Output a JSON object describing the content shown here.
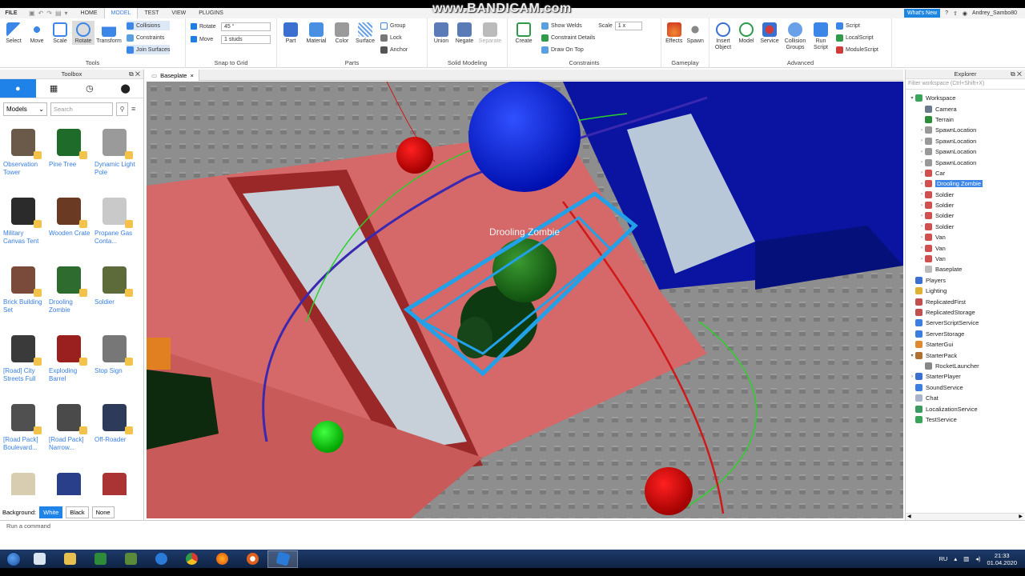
{
  "menubar": {
    "file": "FILE",
    "tabs": [
      "HOME",
      "MODEL",
      "TEST",
      "VIEW",
      "PLUGINS"
    ],
    "active_tab": "MODEL",
    "whats_new": "What's New",
    "user": "Andrey_Sambo80"
  },
  "watermark": "www.BANDICAM.com",
  "ribbon": {
    "tools": {
      "items": [
        "Select",
        "Move",
        "Scale",
        "Rotate",
        "Transform"
      ],
      "toggles": [
        "Collisions",
        "Constraints",
        "Join Surfaces"
      ],
      "label": "Tools"
    },
    "snap": {
      "rotate_label": "Rotate",
      "rotate_value": "45 °",
      "move_label": "Move",
      "move_value": "1 studs",
      "label": "Snap to Grid"
    },
    "parts": {
      "items": [
        "Part",
        "Material",
        "Color",
        "Surface"
      ],
      "side": [
        "Group",
        "Lock",
        "Anchor"
      ],
      "label": "Parts"
    },
    "solid": {
      "items": [
        "Union",
        "Negate",
        "Separate"
      ],
      "label": "Solid Modeling"
    },
    "constraints": {
      "create": "Create",
      "side": [
        "Show Welds",
        "Constraint Details",
        "Draw On Top"
      ],
      "scale_label": "Scale",
      "scale_value": "1 x",
      "label": "Constraints"
    },
    "gameplay": {
      "items": [
        "Effects",
        "Spawn"
      ],
      "label": "Gameplay"
    },
    "advanced": {
      "items": [
        "Insert Object",
        "Model",
        "Service",
        "Collision Groups",
        "Run Script"
      ],
      "scripts": [
        "Script",
        "LocalScript",
        "ModuleScript"
      ],
      "label": "Advanced"
    }
  },
  "toolbox": {
    "title": "Toolbox",
    "category": "Models",
    "search_placeholder": "Search",
    "items": [
      {
        "name": "Observation Tower",
        "color": "#6b5a4a"
      },
      {
        "name": "Pine Tree",
        "color": "#1f6b2a"
      },
      {
        "name": "Dynamic Light Pole",
        "color": "#9a9a9a"
      },
      {
        "name": "Military Canvas Tent",
        "color": "#2b2b2b"
      },
      {
        "name": "Wooden Crate",
        "color": "#6a3a22"
      },
      {
        "name": "Propane Gas Conta...",
        "color": "#c9c9c9"
      },
      {
        "name": "Brick Building Set",
        "color": "#7a4a3a"
      },
      {
        "name": "Drooling Zombie",
        "color": "#2e6b2e"
      },
      {
        "name": "Soldier",
        "color": "#5d6a3a"
      },
      {
        "name": "[Road] City Streets Full",
        "color": "#3a3a3a"
      },
      {
        "name": "Exploding Barrel",
        "color": "#9a1f1f"
      },
      {
        "name": "Stop Sign",
        "color": "#777777"
      },
      {
        "name": "[Road Pack] Boulevard...",
        "color": "#505050"
      },
      {
        "name": "[Road Pack] Narrow...",
        "color": "#4a4a4a"
      },
      {
        "name": "Off-Roader",
        "color": "#2d3a5a"
      },
      {
        "name": "",
        "color": "#d8cdb0"
      },
      {
        "name": "",
        "color": "#2a3f8a"
      },
      {
        "name": "",
        "color": "#a33"
      }
    ],
    "background_label": "Background:",
    "backgrounds": [
      "White",
      "Black",
      "None"
    ]
  },
  "document_tab": "Baseplate",
  "viewport": {
    "selection_label": "Drooling Zombie"
  },
  "explorer": {
    "title": "Explorer",
    "filter_placeholder": "Filter workspace (Ctrl+Shift+X)",
    "items": [
      {
        "label": "Workspace",
        "depth": 0,
        "arrow": "▾",
        "color": "#3aa55a"
      },
      {
        "label": "Camera",
        "depth": 1,
        "arrow": "",
        "color": "#6a7a8a"
      },
      {
        "label": "Terrain",
        "depth": 1,
        "arrow": "",
        "color": "#2e8b3a"
      },
      {
        "label": "SpawnLocation",
        "depth": 1,
        "arrow": "›",
        "color": "#999999"
      },
      {
        "label": "SpawnLocation",
        "depth": 1,
        "arrow": "›",
        "color": "#999999"
      },
      {
        "label": "SpawnLocation",
        "depth": 1,
        "arrow": "›",
        "color": "#999999"
      },
      {
        "label": "SpawnLocation",
        "depth": 1,
        "arrow": "›",
        "color": "#999999"
      },
      {
        "label": "Car",
        "depth": 1,
        "arrow": "›",
        "color": "#d05050"
      },
      {
        "label": "Drooling Zombie",
        "depth": 1,
        "arrow": "›",
        "color": "#d05050",
        "selected": true
      },
      {
        "label": "Soldier",
        "depth": 1,
        "arrow": "›",
        "color": "#d05050"
      },
      {
        "label": "Soldier",
        "depth": 1,
        "arrow": "›",
        "color": "#d05050"
      },
      {
        "label": "Soldier",
        "depth": 1,
        "arrow": "›",
        "color": "#d05050"
      },
      {
        "label": "Soldier",
        "depth": 1,
        "arrow": "›",
        "color": "#d05050"
      },
      {
        "label": "Van",
        "depth": 1,
        "arrow": "›",
        "color": "#d05050"
      },
      {
        "label": "Van",
        "depth": 1,
        "arrow": "›",
        "color": "#d05050"
      },
      {
        "label": "Van",
        "depth": 1,
        "arrow": "›",
        "color": "#d05050"
      },
      {
        "label": "Baseplate",
        "depth": 1,
        "arrow": "",
        "color": "#bbbbbb"
      },
      {
        "label": "Players",
        "depth": 0,
        "arrow": "",
        "color": "#3b6fd0"
      },
      {
        "label": "Lighting",
        "depth": 0,
        "arrow": "",
        "color": "#e0b030"
      },
      {
        "label": "ReplicatedFirst",
        "depth": 0,
        "arrow": "",
        "color": "#c05050"
      },
      {
        "label": "ReplicatedStorage",
        "depth": 0,
        "arrow": "",
        "color": "#c05050"
      },
      {
        "label": "ServerScriptService",
        "depth": 0,
        "arrow": "",
        "color": "#3b7ee0"
      },
      {
        "label": "ServerStorage",
        "depth": 0,
        "arrow": "",
        "color": "#3b7ee0"
      },
      {
        "label": "StarterGui",
        "depth": 0,
        "arrow": "",
        "color": "#e08a30"
      },
      {
        "label": "StarterPack",
        "depth": 0,
        "arrow": "▾",
        "color": "#b07030"
      },
      {
        "label": "RocketLauncher",
        "depth": 1,
        "arrow": "",
        "color": "#888888"
      },
      {
        "label": "StarterPlayer",
        "depth": 0,
        "arrow": "›",
        "color": "#3b6fd0"
      },
      {
        "label": "SoundService",
        "depth": 0,
        "arrow": "",
        "color": "#3b7ee0"
      },
      {
        "label": "Chat",
        "depth": 0,
        "arrow": "",
        "color": "#aab4c8"
      },
      {
        "label": "LocalizationService",
        "depth": 0,
        "arrow": "",
        "color": "#3b9a60"
      },
      {
        "label": "TestService",
        "depth": 0,
        "arrow": "",
        "color": "#3aa55a"
      }
    ]
  },
  "command_bar": {
    "placeholder": "Run a command"
  },
  "taskbar": {
    "language": "RU",
    "time": "21:33",
    "date": "01.04.2020"
  }
}
